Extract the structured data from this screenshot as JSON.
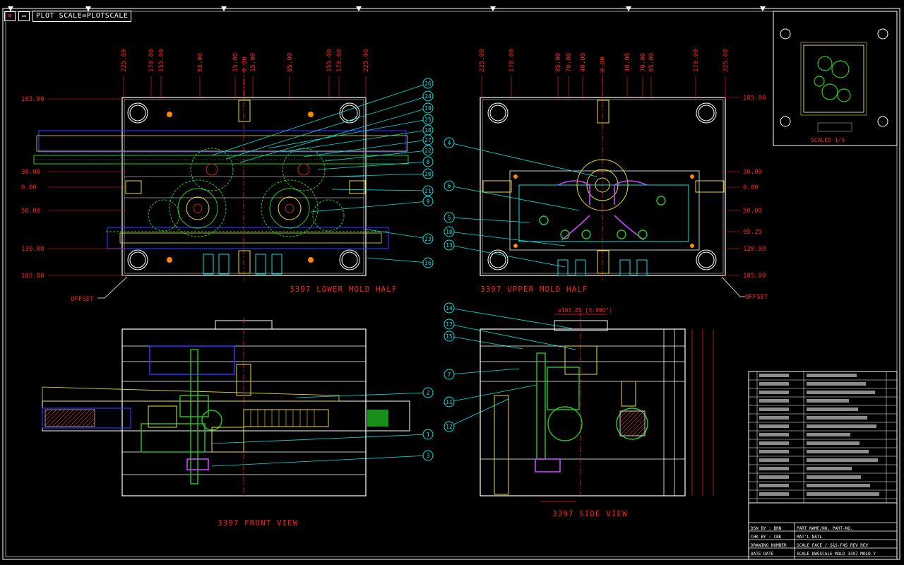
{
  "toolbar": {
    "plot_label": "PLOT SCALE=PLOTSCALE"
  },
  "views": {
    "lower": "3397 LOWER MOLD HALF",
    "upper": "3397 UPPER MOLD HALF",
    "front": "3397 FRONT VIEW",
    "side": "3397 SIDE VIEW"
  },
  "offset_label": "OFFSET",
  "lower_top_dims": [
    "225.00",
    "170.00",
    "155.00",
    "83.00",
    "15.00",
    "0.00",
    "15.00",
    "85.00",
    "155.00",
    "170.00",
    "225.00"
  ],
  "lower_left_dims": [
    "185.00",
    "30.00",
    "0.00",
    "50.00",
    "130.00",
    "185.00"
  ],
  "upper_top_dims": [
    "225.00",
    "170.00",
    "85.00",
    "70.00",
    "40.00",
    "0.00",
    "40.00",
    "70.00",
    "85.00",
    "170.00",
    "225.00"
  ],
  "upper_right_dims": [
    "185.00",
    "30.00",
    "0.00",
    "50.00",
    "95.25",
    "120.00",
    "185.00"
  ],
  "side_width_dim": "ø101.85 [3.990\"]",
  "balloons_lower": [
    "26",
    "24",
    "19",
    "25",
    "18",
    "27",
    "22",
    "8",
    "20",
    "21",
    "9",
    "23",
    "16"
  ],
  "balloons_upper": [
    "4",
    "6",
    "5",
    "10",
    "13"
  ],
  "balloons_front": [
    "2",
    "1",
    "3"
  ],
  "balloons_side": [
    "14",
    "17",
    "15",
    "7",
    "11",
    "12"
  ],
  "inset": {
    "scale_label": "SCALED 1/5"
  },
  "title_block": {
    "rows": [
      [
        "DSN BY : BRN",
        "PART NAME/NO. PART-NO."
      ],
      [
        "CHK BY : CBK",
        "MAT'L NATL"
      ],
      [
        "DRAWING NUMBER",
        "SCALE FACE / S&S-F4S  REV  REV"
      ],
      [
        "DATE DATE",
        "SCALE DWGSCALE     MOLD 3397 MOLD-Y"
      ]
    ]
  },
  "colors": {
    "background": "#000000",
    "outline": "#ffffff",
    "dimension": "#ff2020",
    "leader": "#00e5e5",
    "green": "#22cc22",
    "yellow": "#f0e020",
    "blue": "#3030ff",
    "magenta": "#cc44ff",
    "orange": "#ff8800"
  }
}
